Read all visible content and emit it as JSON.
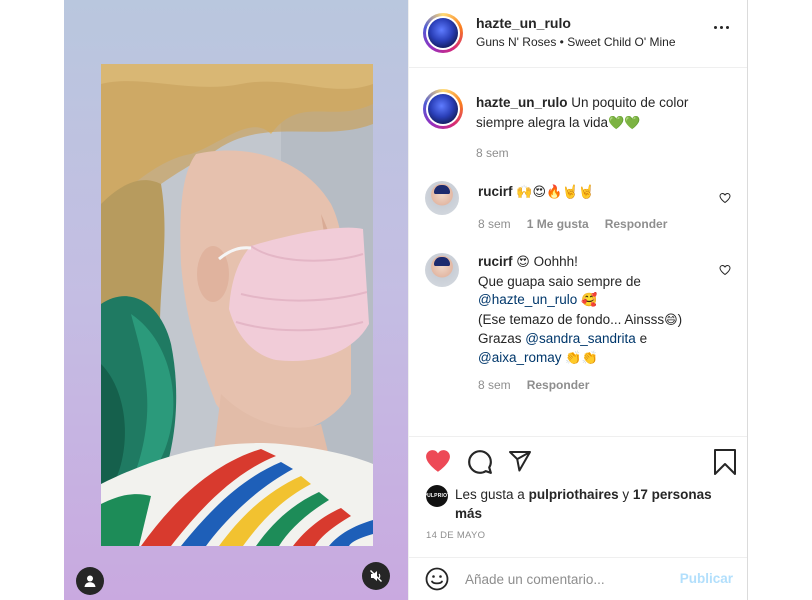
{
  "header": {
    "username": "hazte_un_rulo",
    "audio": "Guns N' Roses • Sweet Child O' Mine",
    "more_icon": "more-dots-icon"
  },
  "caption": {
    "username": "hazte_un_rulo",
    "text": "Un poquito de color siempre alegra la vida",
    "emoji": "💚💚",
    "time": "8 sem"
  },
  "comments": [
    {
      "username": "rucirf",
      "emoji": "🙌😍🔥🤘🤘",
      "time": "8 sem",
      "likes": "1 Me gusta",
      "reply": "Responder"
    },
    {
      "username": "rucirf",
      "line1_emoji": "😍",
      "line1": "Oohhh!",
      "line2": "Que guapa saio sempre de",
      "mention1": "@hazte_un_rulo",
      "mention1_emoji": "🥰",
      "line3": "(Ese temazo de fondo... Ainsss",
      "line3_emoji": "😄",
      "line3_end": ")",
      "line4_pre": "Grazas",
      "mention2": "@sandra_sandrita",
      "line4_post": "e",
      "mention3": "@aixa_romay",
      "line5_emoji": "👏👏",
      "time": "8 sem",
      "reply": "Responder"
    }
  ],
  "actions": {
    "liked_color": "#ed4956",
    "likes_prefix": "Les gusta a",
    "likes_user": "pulpriothaires",
    "likes_and": "y",
    "likes_others": "17 personas más",
    "liker_avatar_text": "PULPRIOT",
    "date": "14 DE MAYO"
  },
  "add_comment": {
    "placeholder": "Añade un comentario...",
    "publish": "Publicar"
  }
}
